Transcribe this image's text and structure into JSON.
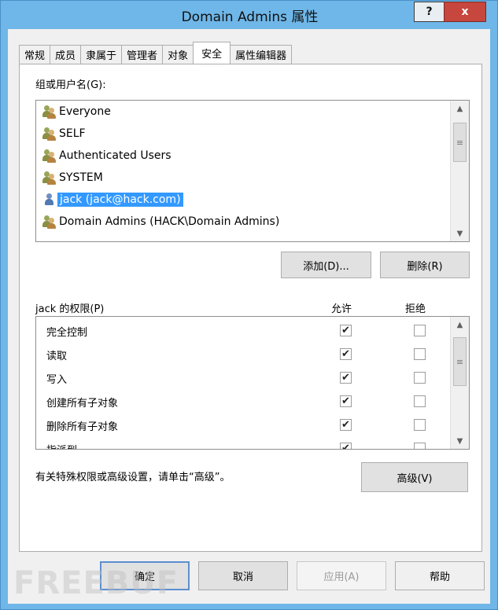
{
  "window": {
    "title": "Domain Admins 属性",
    "help_glyph": "?",
    "close_glyph": "x"
  },
  "tabs": [
    {
      "label": "常规",
      "active": false
    },
    {
      "label": "成员",
      "active": false
    },
    {
      "label": "隶属于",
      "active": false
    },
    {
      "label": "管理者",
      "active": false
    },
    {
      "label": "对象",
      "active": false
    },
    {
      "label": "安全",
      "active": true
    },
    {
      "label": "属性编辑器",
      "active": false
    }
  ],
  "security": {
    "group_label": "组或用户名(G):",
    "principals": [
      {
        "name": "Everyone",
        "icon": "group-icon"
      },
      {
        "name": "SELF",
        "icon": "group-icon"
      },
      {
        "name": "Authenticated Users",
        "icon": "group-icon"
      },
      {
        "name": "SYSTEM",
        "icon": "group-icon"
      },
      {
        "name": "jack (jack@hack.com)",
        "icon": "user-icon",
        "selected": true
      },
      {
        "name": "Domain Admins (HACK\\Domain Admins)",
        "icon": "group-icon"
      }
    ],
    "add_button": "添加(D)...",
    "remove_button": "删除(R)",
    "perm_label": "jack 的权限(P)",
    "allow_header": "允许",
    "deny_header": "拒绝",
    "permissions": [
      {
        "name": "完全控制",
        "allow": true,
        "deny": false
      },
      {
        "name": "读取",
        "allow": true,
        "deny": false
      },
      {
        "name": "写入",
        "allow": true,
        "deny": false
      },
      {
        "name": "创建所有子对象",
        "allow": true,
        "deny": false
      },
      {
        "name": "删除所有子对象",
        "allow": true,
        "deny": false
      },
      {
        "name": "指派到",
        "allow": true,
        "deny": false
      }
    ],
    "advanced_note": "有关特殊权限或高级设置，请单击“高级”。",
    "advanced_button": "高级(V)"
  },
  "footer": {
    "ok": "确定",
    "cancel": "取消",
    "apply": "应用(A)",
    "help": "帮助"
  },
  "watermark": "FREEBUF",
  "icons": {
    "check": "✔",
    "scroll_up": "▲",
    "scroll_down": "▼",
    "thumb_grip": "≡"
  },
  "colors": {
    "title_bar": "#6fb7e8",
    "selection": "#3399ff",
    "close_button": "#c7463d"
  }
}
